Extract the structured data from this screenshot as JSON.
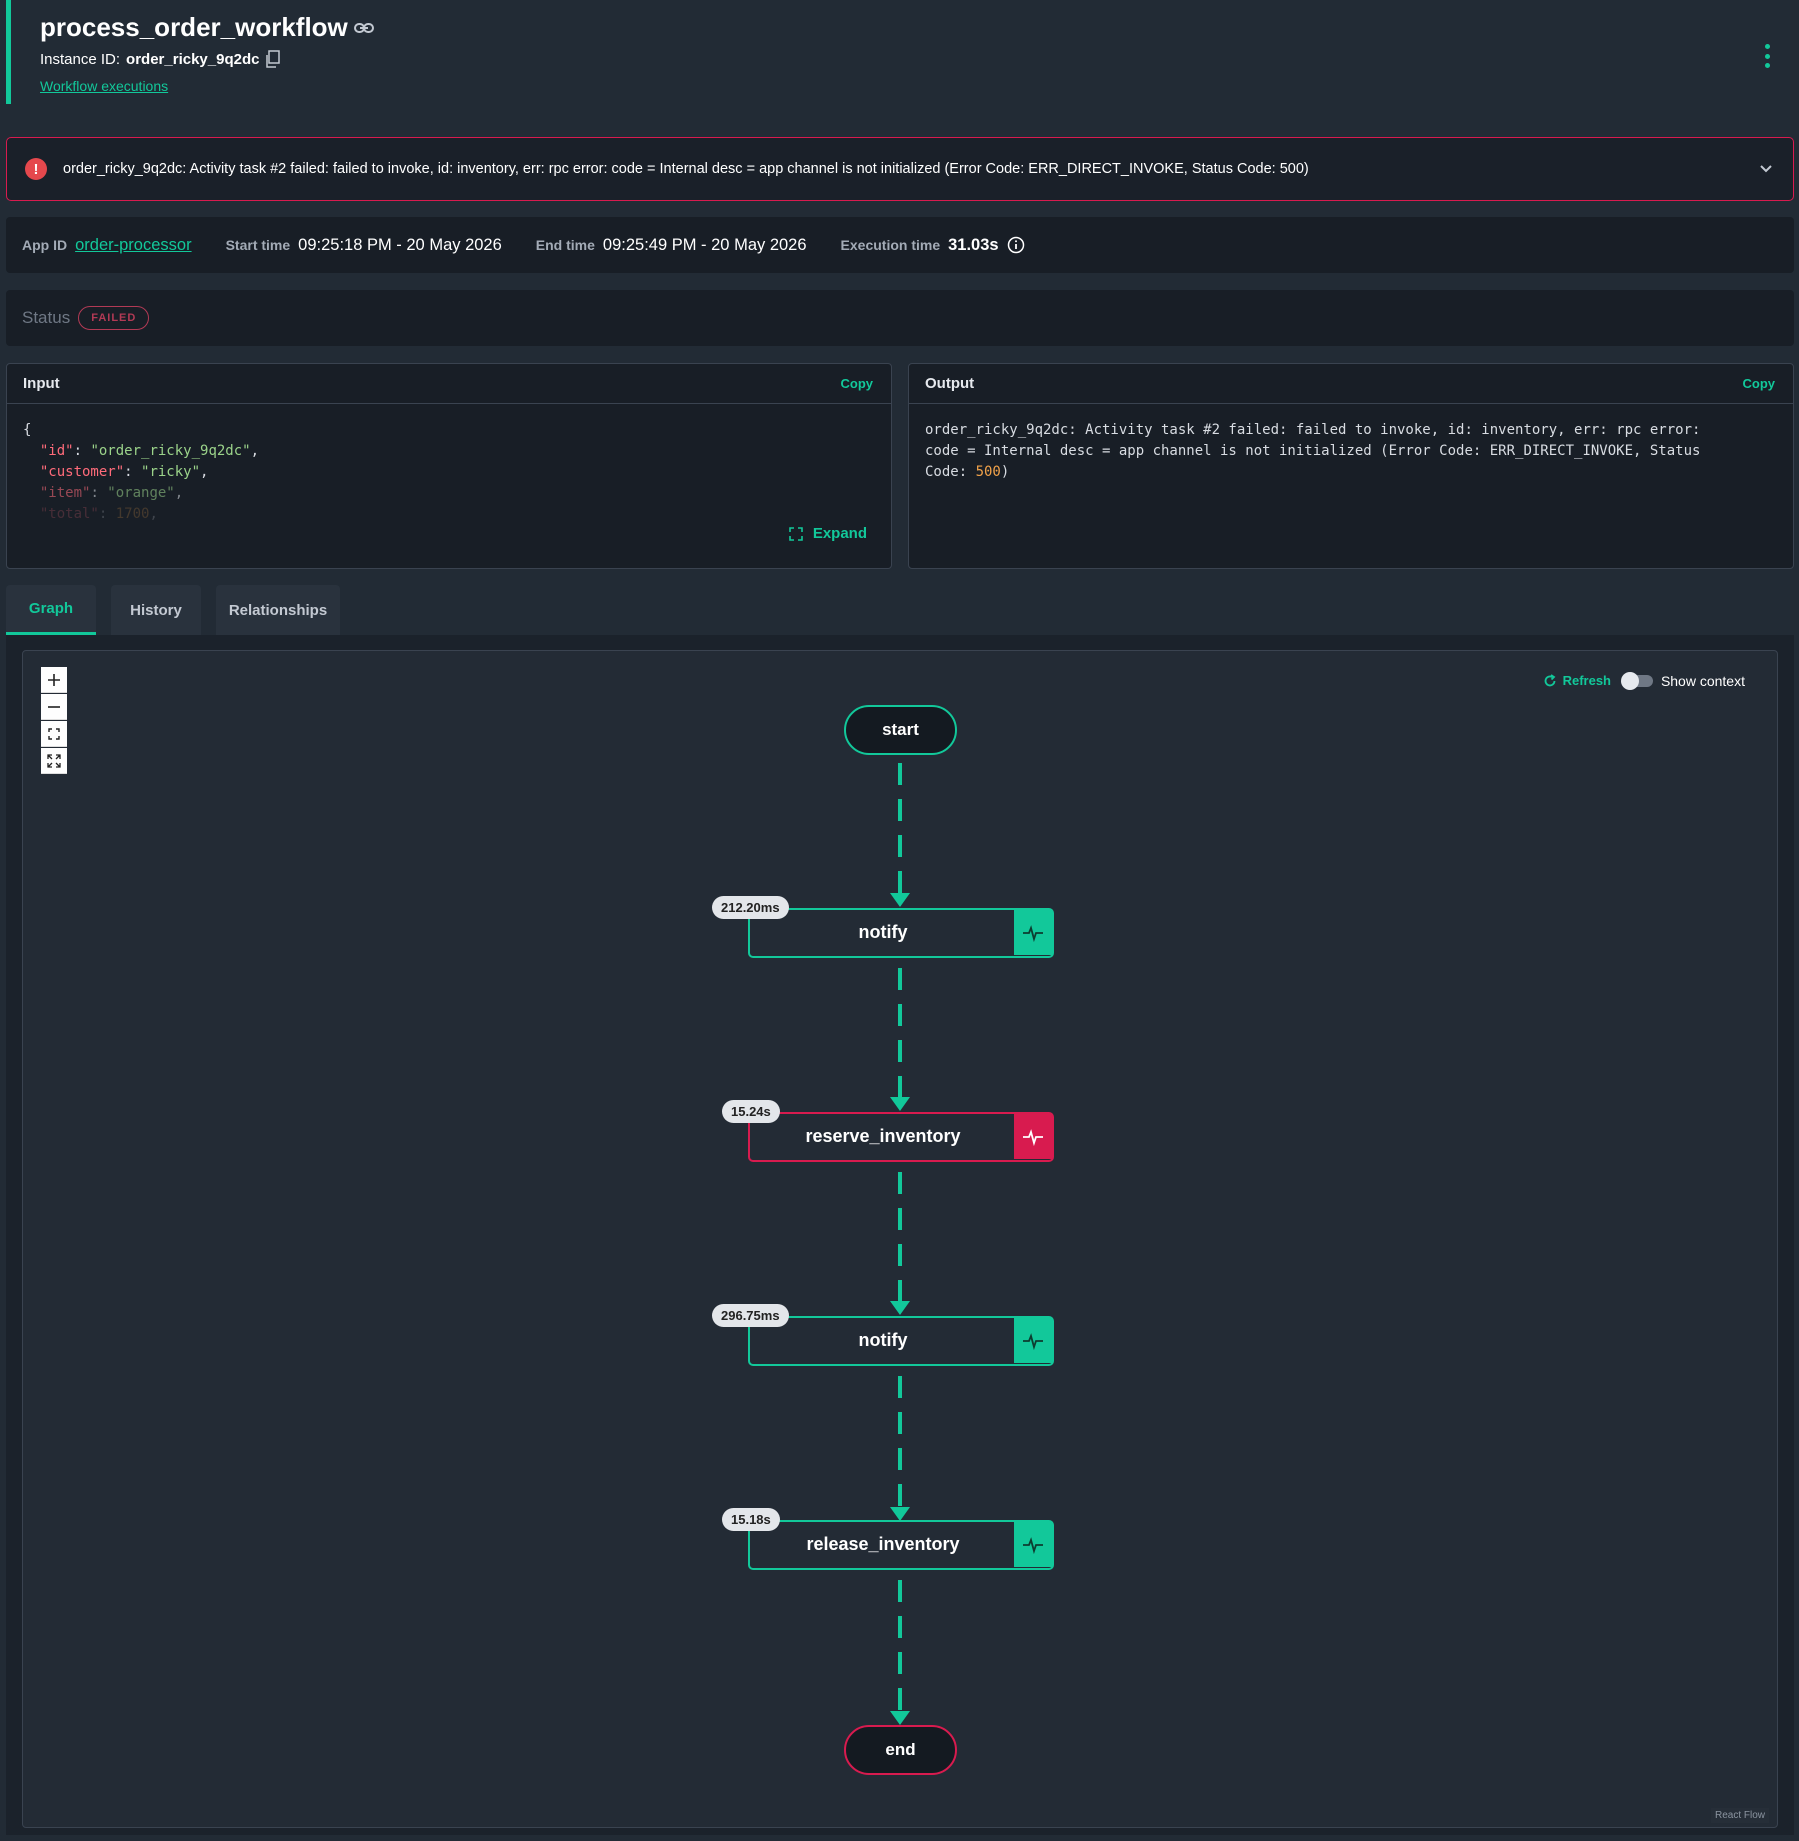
{
  "header": {
    "title": "process_order_workflow",
    "instance_label": "Instance ID:",
    "instance_id": "order_ricky_9q2dc",
    "executions_link": "Workflow executions"
  },
  "error": {
    "message": "order_ricky_9q2dc: Activity task #2 failed: failed to invoke, id: inventory, err: rpc error: code = Internal desc = app channel is not initialized (Error Code: ERR_DIRECT_INVOKE, Status Code: 500)"
  },
  "meta": {
    "app_id_label": "App ID",
    "app_id": "order-processor",
    "start_label": "Start time",
    "start_value": "09:25:18 PM - 20 May 2026",
    "end_label": "End time",
    "end_value": "09:25:49 PM - 20 May 2026",
    "exec_label": "Execution time",
    "exec_value": "31.03s"
  },
  "status": {
    "label": "Status",
    "badge": "FAILED"
  },
  "input_panel": {
    "title": "Input",
    "copy_label": "Copy",
    "expand_label": "Expand",
    "lines": [
      {
        "key": "\"id\"",
        "value": "\"order_ricky_9q2dc\""
      },
      {
        "key": "\"customer\"",
        "value": "\"ricky\""
      },
      {
        "key": "\"item\"",
        "value": "\"orange\""
      },
      {
        "key": "\"total\"",
        "value": "1700"
      }
    ],
    "open_brace": "{"
  },
  "output_panel": {
    "title": "Output",
    "copy_label": "Copy",
    "text_line1": "order_ricky_9q2dc: Activity task #2 failed: failed to invoke, id: inventory, err: rpc error:",
    "text_line2": "code = Internal desc = app channel is not initialized (Error Code: ERR_DIRECT_INVOKE, Status",
    "text_line3_prefix": "Code: ",
    "text_line3_num": "500",
    "text_line3_suffix": ")"
  },
  "tabs": [
    {
      "label": "Graph",
      "active": true
    },
    {
      "label": "History",
      "active": false
    },
    {
      "label": "Relationships",
      "active": false
    }
  ],
  "graph": {
    "refresh_label": "Refresh",
    "show_context_label": "Show context",
    "attribution": "React Flow",
    "start_label": "start",
    "end_label": "end",
    "tasks": [
      {
        "name": "notify",
        "duration": "212.20ms",
        "status": "completed"
      },
      {
        "name": "reserve_inventory",
        "duration": "15.24s",
        "status": "failed"
      },
      {
        "name": "notify",
        "duration": "296.75ms",
        "status": "completed"
      },
      {
        "name": "release_inventory",
        "duration": "15.18s",
        "status": "completed"
      }
    ]
  },
  "colors": {
    "accent": "#12c89a",
    "error": "#d81b4f",
    "background": "#222b35"
  }
}
